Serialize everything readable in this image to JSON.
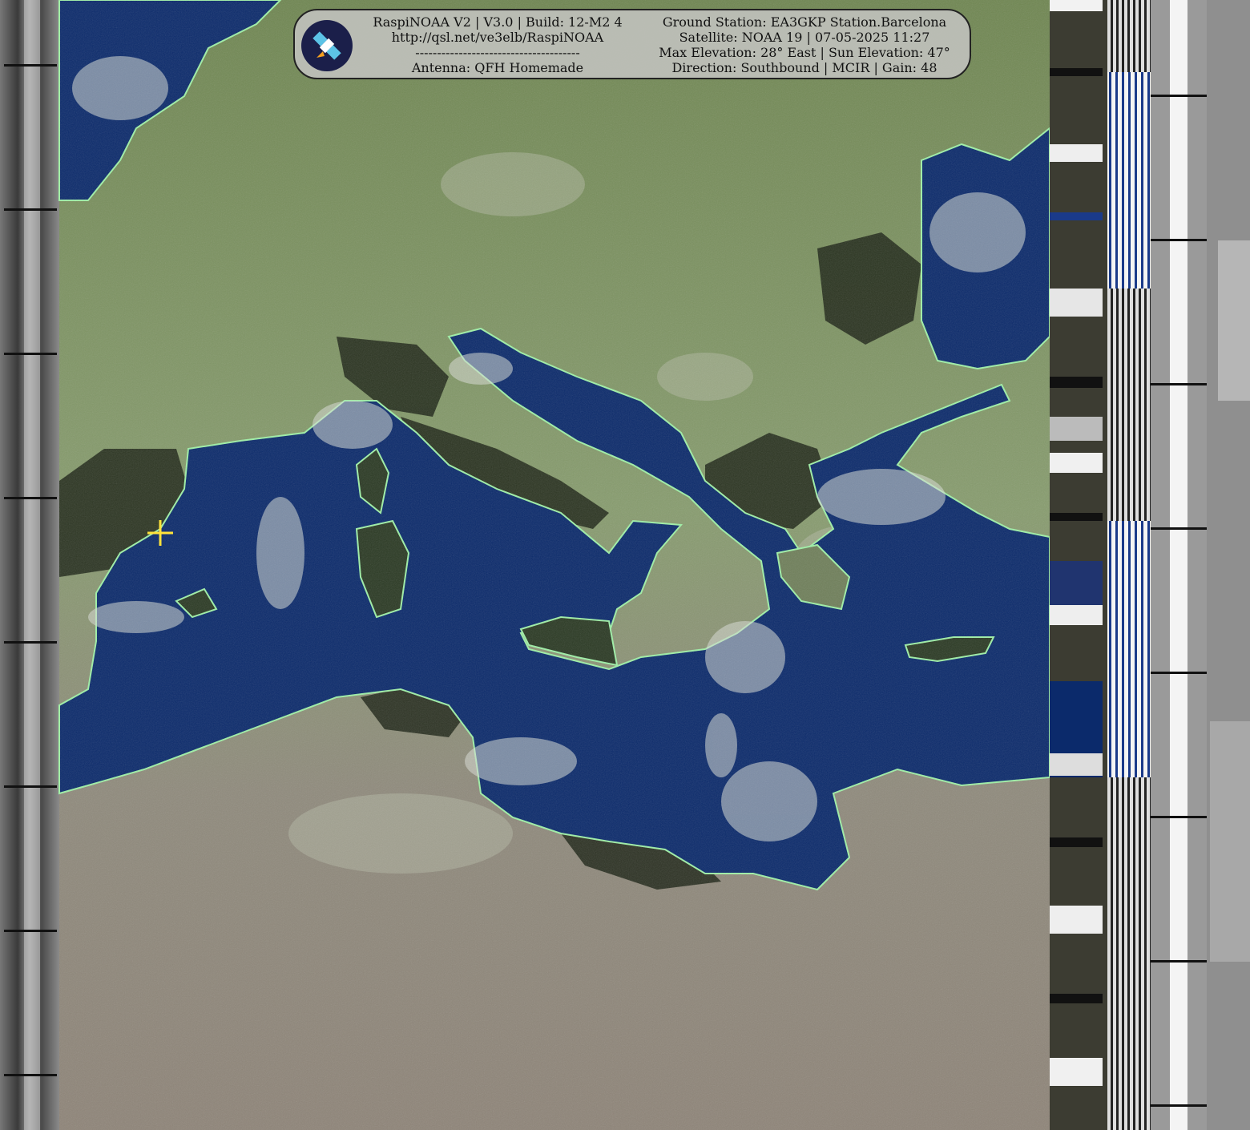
{
  "header": {
    "left_lines": [
      "RaspiNOAA V2 | V3.0 | Build: 12-M2 4",
      "http://qsl.net/ve3elb/RaspiNOAA",
      "--------------------------------------",
      "Antenna: QFH Homemade"
    ],
    "right_lines": [
      "Ground Station: EA3GKP Station.Barcelona",
      "Satellite: NOAA 19 | 07-05-2025 11:27",
      "Max Elevation: 28° East | Sun Elevation: 47°",
      "Direction: Southbound | MCIR | Gain: 48"
    ],
    "logo_icon": "satellite-icon"
  },
  "map": {
    "ground_station_marker": "crosshair-icon",
    "colors": {
      "sea": "#0b2a6b",
      "land_north": "#7f9563",
      "land_south": "#958c80",
      "coastline": "#9ef0a6",
      "marker": "#ffe23a",
      "cloud": "#d9dcd6"
    }
  }
}
